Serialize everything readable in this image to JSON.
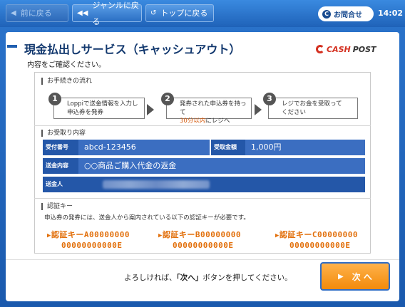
{
  "toolbar": {
    "back_label": "前に戻る",
    "genre_label": "ジャンルに戻る",
    "top_label": "トップに戻る",
    "contact_label": "お問合せ",
    "time": "14:02"
  },
  "header": {
    "title": "現金払出しサービス（キャッシュアウト）",
    "logo_cash": "CASH",
    "logo_post": "POST",
    "subtitle": "内容をご確認ください。"
  },
  "procedure": {
    "section_label": "お手続きの流れ",
    "steps": [
      {
        "num": "1",
        "line1": "Loppiで送金情報を入力し",
        "line2": "申込券を発券"
      },
      {
        "num": "2",
        "line1": "発券された申込券を持って",
        "line2_highlight": "30分以内",
        "line2_rest": "にレジへ"
      },
      {
        "num": "3",
        "line1": "レジでお金を受取って",
        "line2": "ください"
      }
    ]
  },
  "receipt": {
    "section_label": "お受取り内容",
    "receipt_no_label": "受付番号",
    "receipt_no": "abcd-123456",
    "amount_label": "受取金額",
    "amount": "1,000円",
    "content_label": "送金内容",
    "content": "○○商品ご購入代金の返金",
    "sender_label": "送金人"
  },
  "auth": {
    "section_label": "認証キー",
    "note": "申込券の発券には、送金人から案内されている以下の認証キーが必要です。",
    "keys": [
      {
        "line1": "認証キーA00000000",
        "line2": "00000000000E"
      },
      {
        "line1": "認証キーB00000000",
        "line2": "00000000000E"
      },
      {
        "line1": "認証キーC00000000",
        "line2": "00000000000E"
      }
    ]
  },
  "footer": {
    "msg_pre": "よろしければ、",
    "msg_bold": "「次へ」",
    "msg_post": "ボタンを押してください。",
    "next_label": "次 へ"
  },
  "icons": {
    "back": "back-triangle-icon",
    "genre": "double-back-icon",
    "top": "return-arrow-icon",
    "contact": "c-icon",
    "next": "play-icon"
  },
  "colors": {
    "accent_blue": "#1f63b8",
    "table_blue": "#2457a8",
    "orange": "#f28a0b",
    "key_orange": "#e2700c"
  }
}
